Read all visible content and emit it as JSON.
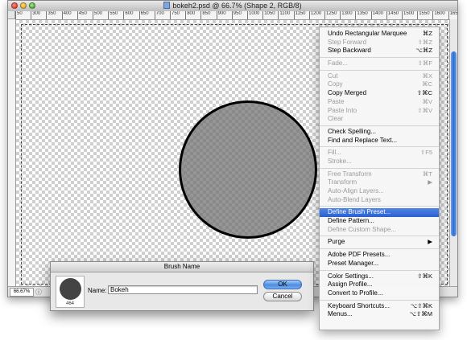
{
  "window": {
    "title": "bokeh2.psd @ 66.7% (Shape 2, RGB/8)",
    "zoom": "66.67%"
  },
  "ruler": {
    "ticks": [
      "50",
      "300",
      "350",
      "400",
      "450",
      "500",
      "550",
      "600",
      "650",
      "700",
      "750",
      "800",
      "850",
      "900",
      "950",
      "1000",
      "1050",
      "1100",
      "1150",
      "1200",
      "1250",
      "1300",
      "1350",
      "1400",
      "1450",
      "1500",
      "1550",
      "1600",
      "1650"
    ]
  },
  "dialog": {
    "title": "Brush Name",
    "name_label": "Name:",
    "name_value": "Bokeh",
    "brush_size": "464",
    "ok_label": "OK",
    "cancel_label": "Cancel"
  },
  "menu": {
    "groups": [
      [
        {
          "label": "Undo Rectangular Marquee",
          "shortcut": "⌘Z",
          "enabled": true
        },
        {
          "label": "Step Forward",
          "shortcut": "⇧⌘Z",
          "enabled": false
        },
        {
          "label": "Step Backward",
          "shortcut": "⌥⌘Z",
          "enabled": true
        }
      ],
      [
        {
          "label": "Fade...",
          "shortcut": "⇧⌘F",
          "enabled": false
        }
      ],
      [
        {
          "label": "Cut",
          "shortcut": "⌘X",
          "enabled": false
        },
        {
          "label": "Copy",
          "shortcut": "⌘C",
          "enabled": false
        },
        {
          "label": "Copy Merged",
          "shortcut": "⇧⌘C",
          "enabled": true
        },
        {
          "label": "Paste",
          "shortcut": "⌘V",
          "enabled": false
        },
        {
          "label": "Paste Into",
          "shortcut": "⇧⌘V",
          "enabled": false
        },
        {
          "label": "Clear",
          "shortcut": "",
          "enabled": false
        }
      ],
      [
        {
          "label": "Check Spelling...",
          "shortcut": "",
          "enabled": true
        },
        {
          "label": "Find and Replace Text...",
          "shortcut": "",
          "enabled": true
        }
      ],
      [
        {
          "label": "Fill...",
          "shortcut": "⇧F5",
          "enabled": false
        },
        {
          "label": "Stroke...",
          "shortcut": "",
          "enabled": false
        }
      ],
      [
        {
          "label": "Free Transform",
          "shortcut": "⌘T",
          "enabled": false
        },
        {
          "label": "Transform",
          "shortcut": "▶",
          "enabled": false
        },
        {
          "label": "Auto-Align Layers...",
          "shortcut": "",
          "enabled": false
        },
        {
          "label": "Auto-Blend Layers",
          "shortcut": "",
          "enabled": false
        }
      ],
      [
        {
          "label": "Define Brush Preset...",
          "shortcut": "",
          "enabled": true,
          "highlighted": true
        },
        {
          "label": "Define Pattern...",
          "shortcut": "",
          "enabled": true
        },
        {
          "label": "Define Custom Shape...",
          "shortcut": "",
          "enabled": false
        }
      ],
      [
        {
          "label": "Purge",
          "shortcut": "▶",
          "enabled": true
        }
      ],
      [
        {
          "label": "Adobe PDF Presets...",
          "shortcut": "",
          "enabled": true
        },
        {
          "label": "Preset Manager...",
          "shortcut": "",
          "enabled": true
        }
      ],
      [
        {
          "label": "Color Settings...",
          "shortcut": "⇧⌘K",
          "enabled": true
        },
        {
          "label": "Assign Profile...",
          "shortcut": "",
          "enabled": true
        },
        {
          "label": "Convert to Profile...",
          "shortcut": "",
          "enabled": true
        }
      ],
      [
        {
          "label": "Keyboard Shortcuts...",
          "shortcut": "⌥⇧⌘K",
          "enabled": true
        },
        {
          "label": "Menus...",
          "shortcut": "⌥⇧⌘M",
          "enabled": true
        }
      ]
    ]
  }
}
